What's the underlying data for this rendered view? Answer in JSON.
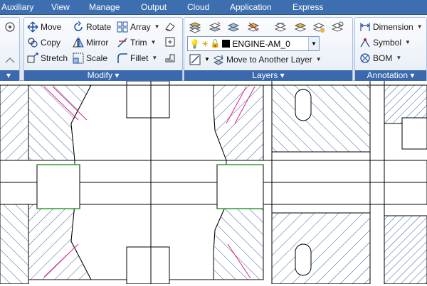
{
  "tabs": [
    "Auxiliary",
    "View",
    "Manage",
    "Output",
    "Cloud",
    "Application",
    "Express"
  ],
  "modify_panel": {
    "title": "Modify",
    "tools": {
      "move": "Move",
      "rotate": "Rotate",
      "array": "Array",
      "copy": "Copy",
      "mirror": "Mirror",
      "trim": "Trim",
      "stretch": "Stretch",
      "scale": "Scale",
      "fillet": "Fillet"
    }
  },
  "layers_panel": {
    "title": "Layers",
    "current_layer": "ENGINE-AM_0",
    "move_to_layer": "Move to Another Layer"
  },
  "annotation_panel": {
    "title": "Annotation",
    "tools": {
      "dimension": "Dimension",
      "symbol": "Symbol",
      "bom": "BOM"
    }
  },
  "colors": {
    "ribbon_tab_bg": "#3d6fb0",
    "panel_title_bg": "#3b69ad",
    "hatch_blue": "#2f5f9e",
    "centerline_pink": "#e0208a",
    "thread_green": "#2e9a2e"
  }
}
